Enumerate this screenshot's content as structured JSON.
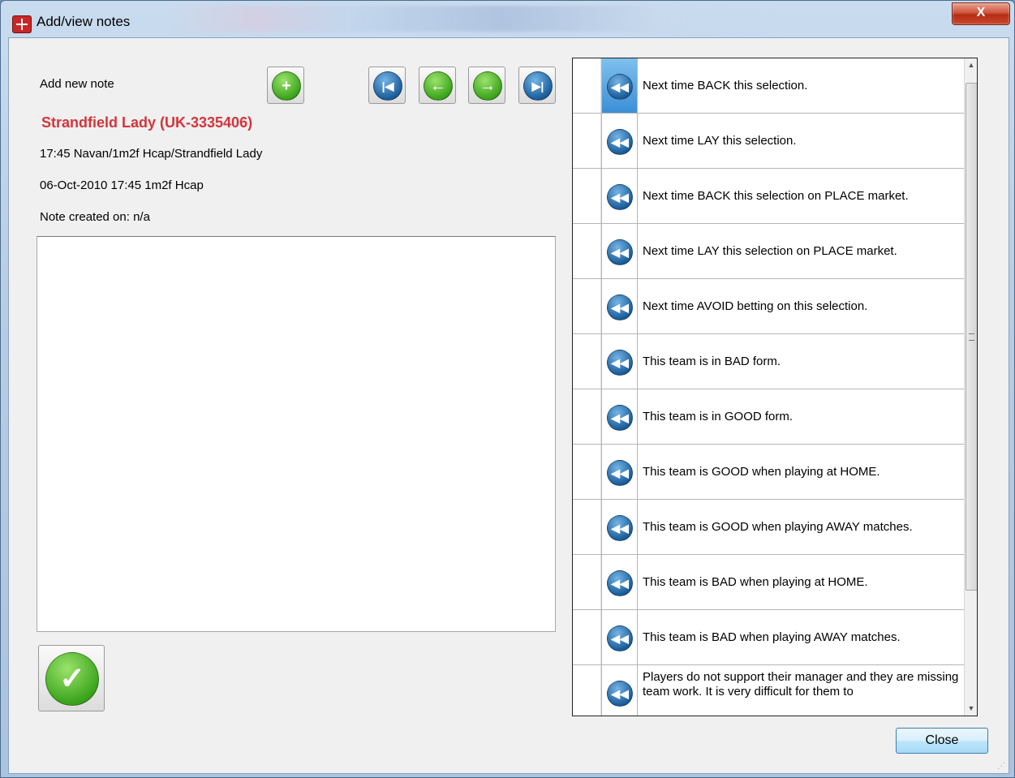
{
  "window": {
    "title": "Add/view notes",
    "close_glyph": "X"
  },
  "left": {
    "add_new_note_label": "Add new note",
    "selection_name": "Strandfield Lady (UK-3335406)",
    "market_path": "17:45 Navan/1m2f Hcap/Strandfield Lady",
    "event_info": "06-Oct-2010 17:45 1m2f Hcap",
    "note_created": "Note created on: n/a",
    "note_text": ""
  },
  "toolbar": {
    "add_icon": "plus-icon",
    "nav_icons": [
      "first-icon",
      "prev-icon",
      "next-icon",
      "last-icon"
    ]
  },
  "templates": [
    {
      "text": "Next time BACK this selection."
    },
    {
      "text": "Next time LAY this selection."
    },
    {
      "text": "Next time BACK this selection on PLACE market."
    },
    {
      "text": "Next time LAY this selection on PLACE market."
    },
    {
      "text": "Next time AVOID betting on this selection."
    },
    {
      "text": "This team is in BAD form."
    },
    {
      "text": "This team is in GOOD form."
    },
    {
      "text": "This team is GOOD when playing at HOME."
    },
    {
      "text": "This team is GOOD when playing AWAY matches."
    },
    {
      "text": "This team is BAD when playing at HOME."
    },
    {
      "text": "This team is BAD when playing AWAY matches."
    },
    {
      "text": "Players do not support their manager and they are missing team work. It is very difficult for them to"
    }
  ],
  "buttons": {
    "close_label": "Close"
  },
  "colors": {
    "selection_red": "#d3343a",
    "green_icon": "#3da51d",
    "blue_icon": "#1d5f9c"
  }
}
